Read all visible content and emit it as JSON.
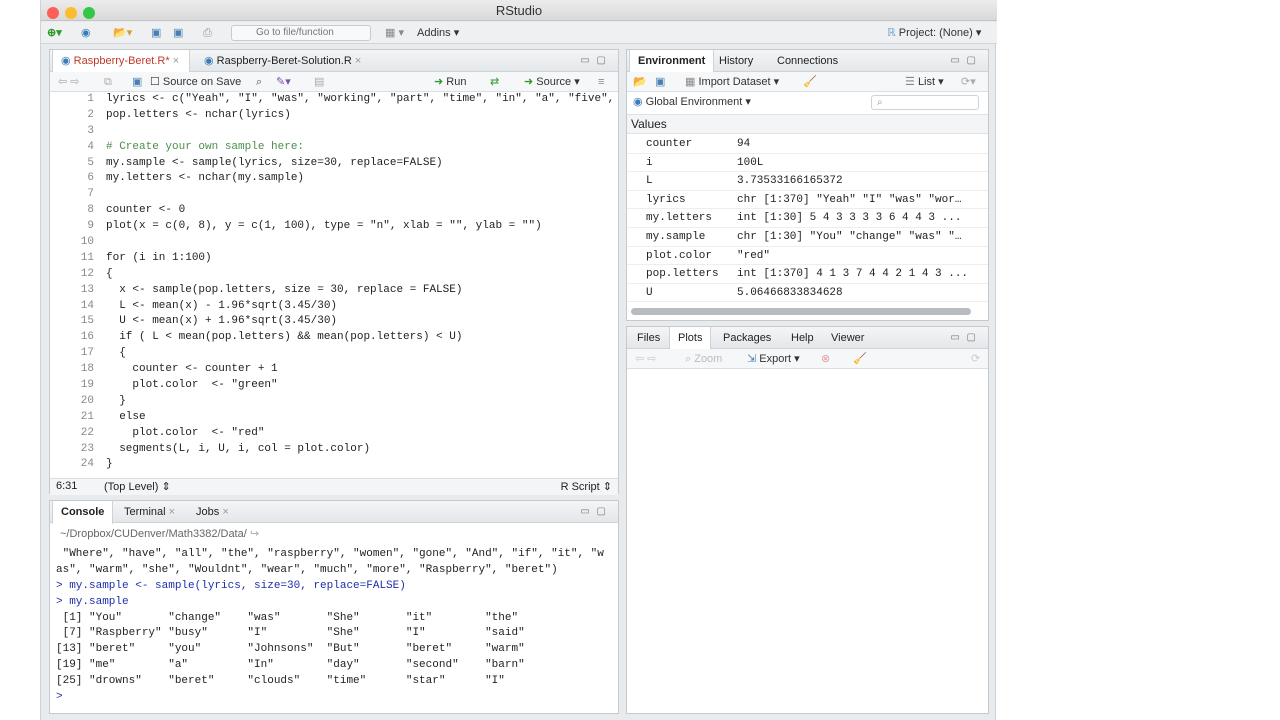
{
  "window": {
    "title": "RStudio"
  },
  "toolbar": {
    "go_to_file": "Go to file/function",
    "addins": "Addins",
    "project": "Project: (None)"
  },
  "editor": {
    "tabs": [
      {
        "label": "Raspberry-Beret.R*"
      },
      {
        "label": "Raspberry-Beret-Solution.R"
      }
    ],
    "source_on_save": "Source on Save",
    "run": "Run",
    "source": "Source",
    "line_numbers": [
      "1",
      "2",
      "3",
      "4",
      "5",
      "6",
      "7",
      "8",
      "9",
      "10",
      "11",
      "12",
      "13",
      "14",
      "15",
      "16",
      "17",
      "18",
      "19",
      "20",
      "21",
      "22",
      "23",
      "24"
    ],
    "lines": [
      "lyrics <- c(\"Yeah\", \"I\", \"was\", \"working\", \"part\", \"time\", \"in\", \"a\", \"five\",",
      "pop.letters <- nchar(lyrics)",
      "",
      "# Create your own sample here:",
      "my.sample <- sample(lyrics, size=30, replace=FALSE)",
      "my.letters <- nchar(my.sample)",
      "",
      "counter <- 0",
      "plot(x = c(0, 8), y = c(1, 100), type = \"n\", xlab = \"\", ylab = \"\")",
      "",
      "for (i in 1:100)",
      "{",
      "  x <- sample(pop.letters, size = 30, replace = FALSE)",
      "  L <- mean(x) - 1.96*sqrt(3.45/30)",
      "  U <- mean(x) + 1.96*sqrt(3.45/30)",
      "  if ( L < mean(pop.letters) && mean(pop.letters) < U)",
      "  {",
      "    counter <- counter + 1",
      "    plot.color  <- \"green\"",
      "  }",
      "  else",
      "    plot.color  <- \"red\"",
      "  segments(L, i, U, i, col = plot.color)",
      "}"
    ],
    "status": {
      "position": "6:31",
      "scope": "(Top Level)",
      "type": "R Script"
    }
  },
  "console": {
    "tabs": [
      {
        "label": "Console"
      },
      {
        "label": "Terminal"
      },
      {
        "label": "Jobs"
      }
    ],
    "path": "~/Dropbox/CUDenver/Math3382/Data/",
    "lines": [
      " \"Where\", \"have\", \"all\", \"the\", \"raspberry\", \"women\", \"gone\", \"And\", \"if\", \"it\", \"w",
      "as\", \"warm\", \"she\", \"Wouldnt\", \"wear\", \"much\", \"more\", \"Raspberry\", \"beret\")",
      "> my.sample <- sample(lyrics, size=30, replace=FALSE)",
      "> my.sample",
      " [1] \"You\"       \"change\"    \"was\"       \"She\"       \"it\"        \"the\"",
      " [7] \"Raspberry\" \"busy\"      \"I\"         \"She\"       \"I\"         \"said\"",
      "[13] \"beret\"     \"you\"       \"Johnsons\"  \"But\"       \"beret\"     \"warm\"",
      "[19] \"me\"        \"a\"         \"In\"        \"day\"       \"second\"    \"barn\"",
      "[25] \"drowns\"    \"beret\"     \"clouds\"    \"time\"      \"star\"      \"I\"",
      "> "
    ]
  },
  "environment": {
    "tabs": [
      {
        "label": "Environment"
      },
      {
        "label": "History"
      },
      {
        "label": "Connections"
      }
    ],
    "import_dataset": "Import Dataset",
    "list_view": "List",
    "scope": "Global Environment",
    "section": "Values",
    "rows": [
      {
        "name": "counter",
        "value": "94"
      },
      {
        "name": "i",
        "value": "100L"
      },
      {
        "name": "L",
        "value": "3.73533166165372"
      },
      {
        "name": "lyrics",
        "value": "chr [1:370] \"Yeah\" \"I\" \"was\" \"wor…"
      },
      {
        "name": "my.letters",
        "value": "int [1:30] 5 4 3 3 3 3 6 4 4 3 ..."
      },
      {
        "name": "my.sample",
        "value": "chr [1:30] \"You\" \"change\" \"was\" \"…"
      },
      {
        "name": "plot.color",
        "value": "\"red\""
      },
      {
        "name": "pop.letters",
        "value": "int [1:370] 4 1 3 7 4 4 2 1 4 3 ..."
      },
      {
        "name": "U",
        "value": "5.06466833834628"
      }
    ]
  },
  "files": {
    "tabs": [
      {
        "label": "Files"
      },
      {
        "label": "Plots"
      },
      {
        "label": "Packages"
      },
      {
        "label": "Help"
      },
      {
        "label": "Viewer"
      }
    ],
    "zoom": "Zoom",
    "export": "Export"
  }
}
